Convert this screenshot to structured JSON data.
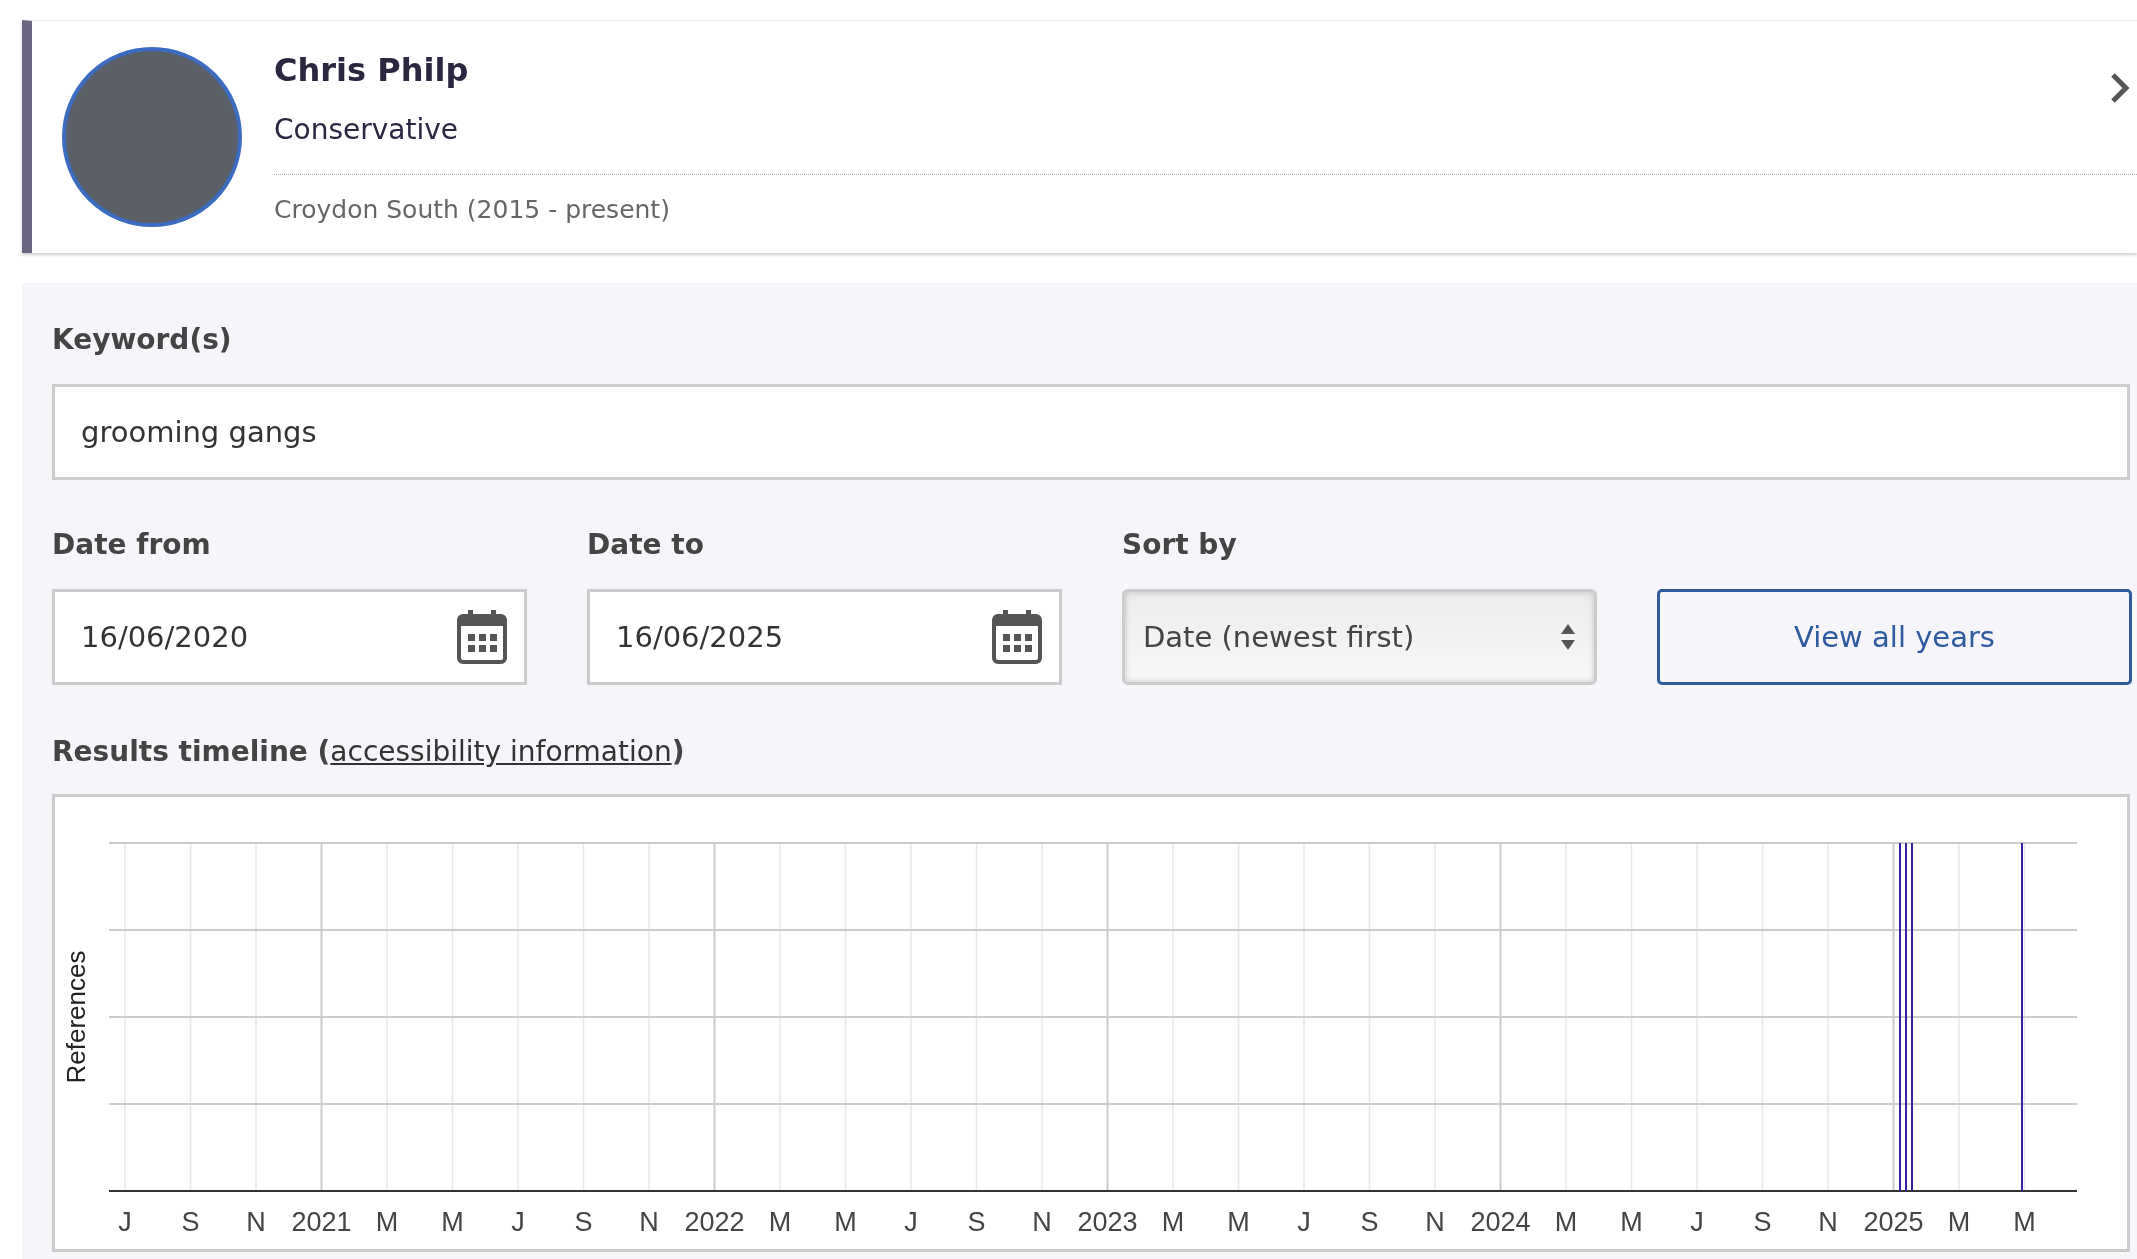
{
  "member": {
    "name": "Chris Philp",
    "party": "Conservative",
    "constituency": "Croydon South (2015 - present)"
  },
  "keyword": {
    "label": "Keyword(s)",
    "value": "grooming gangs"
  },
  "date_from": {
    "label": "Date from",
    "value": "16/06/2020"
  },
  "date_to": {
    "label": "Date to",
    "value": "16/06/2025"
  },
  "sort": {
    "label": "Sort by",
    "value": "Date (newest first)"
  },
  "view_all_button": "View all years",
  "timeline": {
    "before": "Results timeline (",
    "link": "accessibility information",
    "after": ")",
    "ylabel": "References",
    "x_labels": [
      {
        "text": "J",
        "kind": "month"
      },
      {
        "text": "S",
        "kind": "month"
      },
      {
        "text": "N",
        "kind": "month"
      },
      {
        "text": "2021",
        "kind": "year"
      },
      {
        "text": "M",
        "kind": "month"
      },
      {
        "text": "M",
        "kind": "month"
      },
      {
        "text": "J",
        "kind": "month"
      },
      {
        "text": "S",
        "kind": "month"
      },
      {
        "text": "N",
        "kind": "month"
      },
      {
        "text": "2022",
        "kind": "year"
      },
      {
        "text": "M",
        "kind": "month"
      },
      {
        "text": "M",
        "kind": "month"
      },
      {
        "text": "J",
        "kind": "month"
      },
      {
        "text": "S",
        "kind": "month"
      },
      {
        "text": "N",
        "kind": "month"
      },
      {
        "text": "2023",
        "kind": "year"
      },
      {
        "text": "M",
        "kind": "month"
      },
      {
        "text": "M",
        "kind": "month"
      },
      {
        "text": "J",
        "kind": "month"
      },
      {
        "text": "S",
        "kind": "month"
      },
      {
        "text": "N",
        "kind": "month"
      },
      {
        "text": "2024",
        "kind": "year"
      },
      {
        "text": "M",
        "kind": "month"
      },
      {
        "text": "M",
        "kind": "month"
      },
      {
        "text": "J",
        "kind": "month"
      },
      {
        "text": "S",
        "kind": "month"
      },
      {
        "text": "N",
        "kind": "month"
      },
      {
        "text": "2025",
        "kind": "year"
      },
      {
        "text": "M",
        "kind": "month"
      },
      {
        "text": "M",
        "kind": "month"
      }
    ]
  }
}
